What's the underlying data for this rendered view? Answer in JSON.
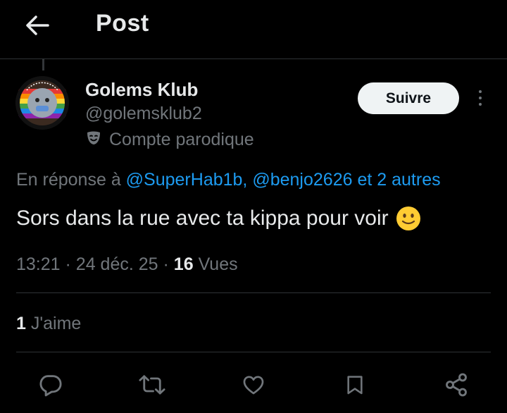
{
  "header": {
    "title": "Post",
    "back_icon": "arrow-left-icon"
  },
  "author": {
    "name": "Golems Klub",
    "handle": "@golemsklub2",
    "badge_icon": "theater-mask-icon",
    "badge_label": "Compte parodique",
    "avatar_ring_text": "I SUPPORT THE CURRENT THING"
  },
  "follow_button": {
    "label": "Suivre"
  },
  "reply_to": {
    "prefix": "En réponse à",
    "mentions": [
      "@SuperHab1b,",
      "@benjo2626"
    ],
    "suffix": "et 2 autres"
  },
  "tweet": {
    "text": "Sors dans la rue avec ta kippa pour voir",
    "emoji": "slightly-smiling-face"
  },
  "meta": {
    "time": "13:21",
    "sep": "·",
    "date": "24 déc. 25",
    "views_count": "16",
    "views_label": "Vues"
  },
  "likes": {
    "count": "1",
    "label": "J'aime"
  },
  "actions": [
    "reply-icon",
    "repost-icon",
    "like-icon",
    "bookmark-icon",
    "share-icon"
  ],
  "colors": {
    "background": "#000000",
    "text": "#e7e9ea",
    "muted": "#71767b",
    "link": "#1d9bf0",
    "divider": "#2f3336"
  }
}
